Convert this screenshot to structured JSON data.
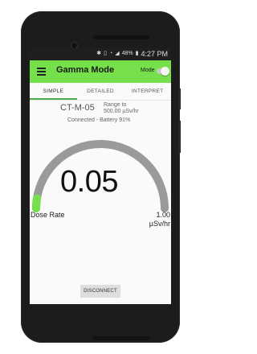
{
  "statusbar": {
    "icons": [
      "bluetooth-icon",
      "vibrate-icon",
      "wifi-icon",
      "signal-icon"
    ],
    "battery": "48%",
    "time": "4:27 PM"
  },
  "appbar": {
    "title": "Gamma Mode",
    "mode_label": "Mode",
    "mode_toggle_on": false
  },
  "tabs": [
    {
      "label": "SIMPLE",
      "active": true
    },
    {
      "label": "DETAILED",
      "active": false
    },
    {
      "label": "INTERPRET",
      "active": false
    }
  ],
  "device": {
    "id": "CT-M-05",
    "range_label": "Range to",
    "range_value": "500.00 µSv/hr",
    "connection": "Connected - Battery 91%"
  },
  "gauge": {
    "value": "0.05",
    "fill_fraction": 0.05,
    "left_label": "Dose Rate",
    "right_value": "1.00",
    "right_unit": "µSv/hr",
    "track_color": "#9a9a9a",
    "fill_color": "#76e04a"
  },
  "actions": {
    "disconnect_label": "DISCONNECT"
  },
  "colors": {
    "appbar": "#76e04a",
    "tab_indicator": "#4caf50"
  }
}
